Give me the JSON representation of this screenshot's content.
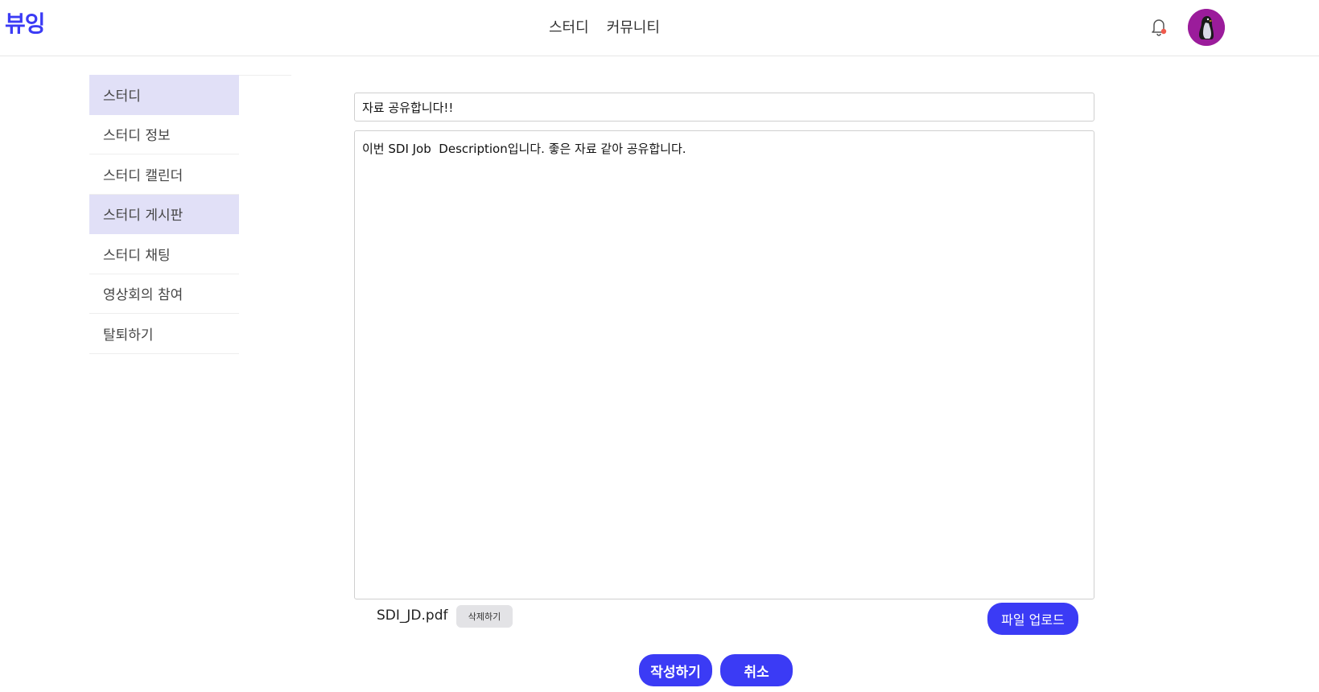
{
  "app": {
    "logo_text": "뷰잉",
    "brand_color": "#3b3bf5"
  },
  "header": {
    "nav": [
      {
        "label": "스터디"
      },
      {
        "label": "커뮤니티"
      }
    ],
    "notification_icon": "bell-icon",
    "avatar_icon": "penguin-avatar"
  },
  "sidebar": {
    "items": [
      {
        "label": "스터디",
        "active": true
      },
      {
        "label": "스터디 정보",
        "active": false
      },
      {
        "label": "스터디 캘린더",
        "active": false
      },
      {
        "label": "스터디 게시판",
        "active": true
      },
      {
        "label": "스터디 채팅",
        "active": false
      },
      {
        "label": "영상회의 참여",
        "active": false
      },
      {
        "label": "탈퇴하기",
        "active": false
      }
    ]
  },
  "editor": {
    "title_value": "자료 공유합니다!!",
    "body_value": "이번 SDI Job  Description입니다. 좋은 자료 같아 공유합니다."
  },
  "attachment": {
    "file_name": "SDI_JD.pdf",
    "delete_label": "삭제하기",
    "upload_label": "파일 업로드"
  },
  "actions": {
    "submit_label": "작성하기",
    "cancel_label": "취소"
  }
}
